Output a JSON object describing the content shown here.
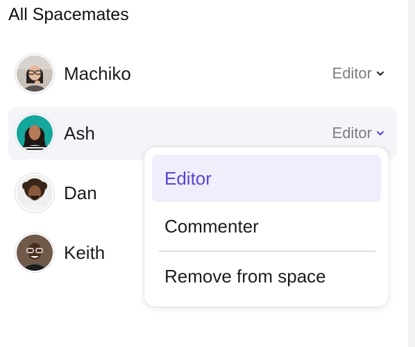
{
  "section": {
    "heading": "All Spacemates"
  },
  "members": [
    {
      "name": "Machiko",
      "role": "Editor"
    },
    {
      "name": "Ash",
      "role": "Editor"
    },
    {
      "name": "Dan"
    },
    {
      "name": "Keith"
    }
  ],
  "role_menu": {
    "items": [
      {
        "label": "Editor",
        "selected": true
      },
      {
        "label": "Commenter",
        "selected": false
      },
      {
        "label": "Remove from space",
        "selected": false
      }
    ]
  },
  "colors": {
    "accent": "#5b43d6",
    "selected_bg": "#f0eefb",
    "hover_row_bg": "#f4f4f9",
    "muted_text": "#7c7c82"
  },
  "icons": {
    "chevron": "chevron-down-icon"
  }
}
